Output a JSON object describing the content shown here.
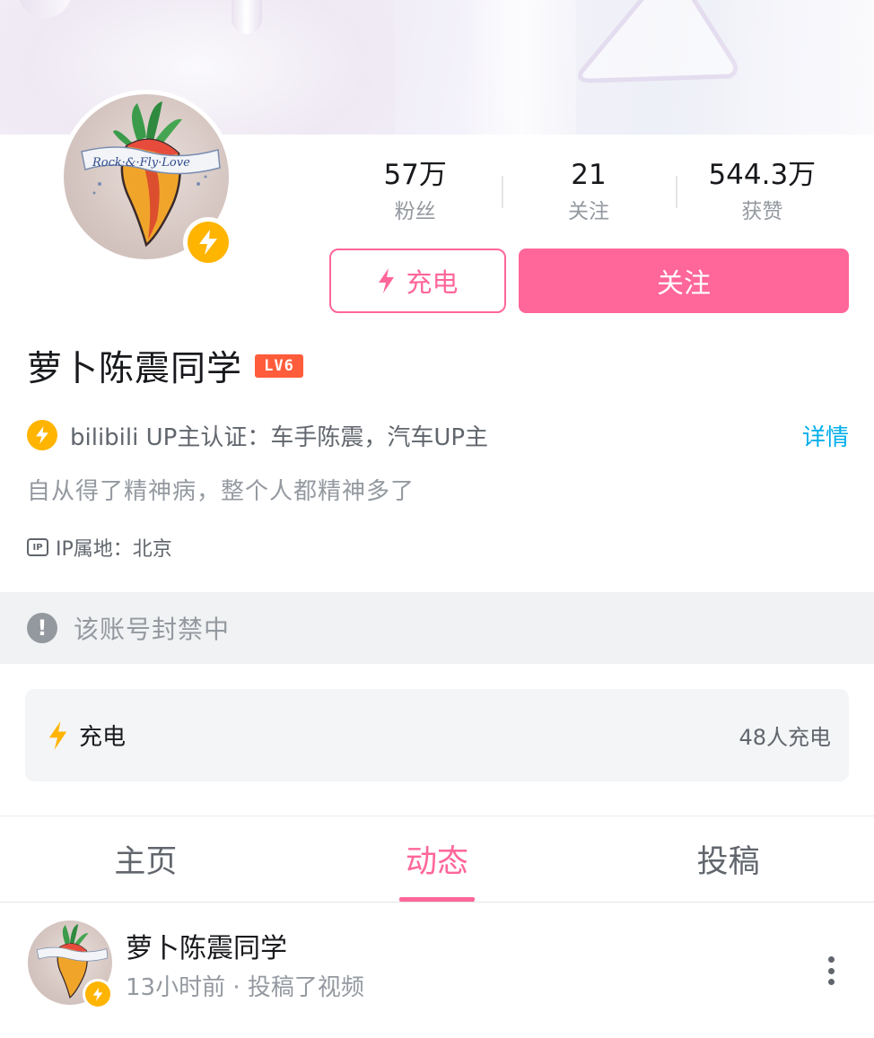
{
  "profile": {
    "name": "萝卜陈震同学",
    "level": "LV6",
    "certification": "bilibili UP主认证：车手陈震，汽车UP主",
    "certification_detail": "详情",
    "bio": "自从得了精神病，整个人都精神多了",
    "ip_icon": "IP",
    "ip_location": "IP属地：北京"
  },
  "stats": [
    {
      "value": "57万",
      "label": "粉丝"
    },
    {
      "value": "21",
      "label": "关注"
    },
    {
      "value": "544.3万",
      "label": "获赞"
    }
  ],
  "actions": {
    "charge_label": "充电",
    "follow_label": "关注"
  },
  "notice": {
    "icon": "!",
    "text": "该账号封禁中"
  },
  "charge_card": {
    "title": "充电",
    "count": "48人充电"
  },
  "tabs": [
    {
      "label": "主页",
      "active": false
    },
    {
      "label": "动态",
      "active": true
    },
    {
      "label": "投稿",
      "active": false
    }
  ],
  "feed": {
    "author": "萝卜陈震同学",
    "meta": "13小时前 · 投稿了视频"
  },
  "colors": {
    "accent_pink": "#ff6699",
    "link_blue": "#00aeec",
    "verify_yellow": "#ffb400",
    "level_red": "#ff5c3b"
  },
  "icons": [
    "lightning-icon",
    "verified-badge-icon",
    "ip-icon",
    "exclamation-icon",
    "more-vertical-icon"
  ]
}
